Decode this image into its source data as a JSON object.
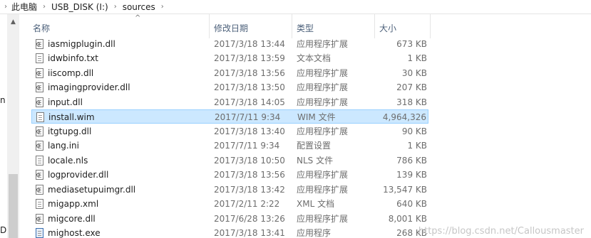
{
  "address_bar": {
    "crumbs": [
      "此电脑",
      "USB_DISK (I:)",
      "sources"
    ]
  },
  "nav_pane": {
    "partial_labels": [
      "n",
      "D:"
    ]
  },
  "columns": {
    "name": "名称",
    "date": "修改日期",
    "type": "类型",
    "size": "大小",
    "sort_indicator": "^"
  },
  "files": [
    {
      "name": "iasmigplugin.dll",
      "date": "2017/3/18 13:44",
      "type": "应用程序扩展",
      "size": "673 KB",
      "icon": "gear-file-icon"
    },
    {
      "name": "idwbinfo.txt",
      "date": "2017/3/18 13:59",
      "type": "文本文档",
      "size": "1 KB",
      "icon": "text-file-icon"
    },
    {
      "name": "iiscomp.dll",
      "date": "2017/3/18 13:56",
      "type": "应用程序扩展",
      "size": "30 KB",
      "icon": "gear-file-icon"
    },
    {
      "name": "imagingprovider.dll",
      "date": "2017/3/18 13:50",
      "type": "应用程序扩展",
      "size": "207 KB",
      "icon": "gear-file-icon"
    },
    {
      "name": "input.dll",
      "date": "2017/3/18 14:05",
      "type": "应用程序扩展",
      "size": "318 KB",
      "icon": "gear-file-icon"
    },
    {
      "name": "install.wim",
      "date": "2017/7/11 9:34",
      "type": "WIM 文件",
      "size": "4,964,326",
      "icon": "file-icon",
      "selected": true
    },
    {
      "name": "itgtupg.dll",
      "date": "2017/3/18 13:40",
      "type": "应用程序扩展",
      "size": "90 KB",
      "icon": "gear-file-icon"
    },
    {
      "name": "lang.ini",
      "date": "2017/7/11 9:34",
      "type": "配置设置",
      "size": "1 KB",
      "icon": "gear-file-icon"
    },
    {
      "name": "locale.nls",
      "date": "2017/3/18 10:50",
      "type": "NLS 文件",
      "size": "786 KB",
      "icon": "file-icon"
    },
    {
      "name": "logprovider.dll",
      "date": "2017/3/18 13:56",
      "type": "应用程序扩展",
      "size": "139 KB",
      "icon": "gear-file-icon"
    },
    {
      "name": "mediasetupuimgr.dll",
      "date": "2017/3/18 13:42",
      "type": "应用程序扩展",
      "size": "13,547 KB",
      "icon": "gear-file-icon"
    },
    {
      "name": "migapp.xml",
      "date": "2017/2/11 2:22",
      "type": "XML 文档",
      "size": "640 KB",
      "icon": "text-file-icon"
    },
    {
      "name": "migcore.dll",
      "date": "2017/6/28 13:26",
      "type": "应用程序扩展",
      "size": "8,001 KB",
      "icon": "gear-file-icon"
    },
    {
      "name": "mighost.exe",
      "date": "2017/3/18 13:41",
      "type": "应用程序",
      "size": "268 KB",
      "icon": "exe-file-icon"
    }
  ],
  "colors": {
    "selection_bg": "#cce8ff",
    "selection_border": "#99d1ff",
    "header_text": "#4c607a"
  },
  "watermark": "https://blog.csdn.net/Callousmaster"
}
